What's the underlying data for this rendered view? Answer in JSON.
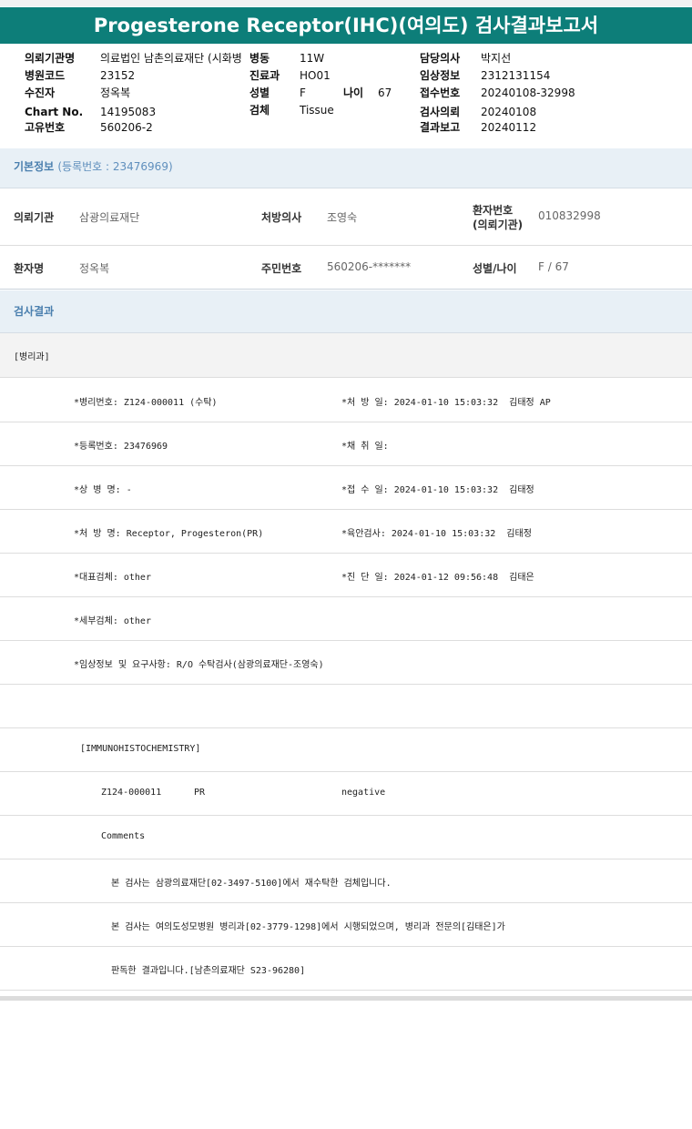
{
  "title": "Progesterone Receptor(IHC)(여의도) 검사결과보고서",
  "header": {
    "r1": {
      "l1": "의뢰기관명",
      "v1": "의료법인 남촌의료재단 (시화병",
      "l2": "병동",
      "v2": "11W",
      "l3": "담당의사",
      "v3": "박지선"
    },
    "r2": {
      "l1": "병원코드",
      "v1": "23152",
      "l2": "진료과",
      "v2": "HO01",
      "l3": "임상정보",
      "v3": "2312131154"
    },
    "r3": {
      "l1": "수진자",
      "v1": "정옥복",
      "l2": "성별",
      "v2": "F",
      "l2b": "나이",
      "v2b": "67",
      "l3": "접수번호",
      "v3": "20240108-32998"
    },
    "r4": {
      "l1": "Chart No.",
      "v1": "14195083",
      "l2": "검체",
      "v2": "Tissue",
      "l3": "검사의뢰",
      "v3": "20240108"
    },
    "r5": {
      "l1": "고유번호",
      "v1": "560206-2",
      "l3": "결과보고",
      "v3": "20240112"
    }
  },
  "basic": {
    "title": "기본정보",
    "subtitle": "(등록번호 : 23476969)",
    "r1": {
      "l1": "의뢰기관",
      "v1": "삼광의료재단",
      "l2": "처방의사",
      "v2": "조영숙",
      "l3a": "환자번호",
      "l3b": "(의뢰기관)",
      "v3": "010832998"
    },
    "r2": {
      "l1": "환자명",
      "v1": "정옥복",
      "l2": "주민번호",
      "v2": "560206-*******",
      "l3": "성별/나이",
      "v3": "F / 67"
    }
  },
  "results": {
    "title": "검사결과",
    "dept": "[병리과]",
    "lines": [
      {
        "left": "*병리번호: Z124-000011 (수탁)",
        "right": "*처 방 일: 2024-01-10 15:03:32  김태정 AP"
      },
      {
        "left": "*등록번호: 23476969",
        "right": "*채 취 일:"
      },
      {
        "left": "*상 병 명: -",
        "right": "*접 수 일: 2024-01-10 15:03:32  김태정"
      },
      {
        "left": "*처 방 명: Receptor, Progesteron(PR)",
        "right": "*육안검사: 2024-01-10 15:03:32  김태정"
      },
      {
        "left": "*대표검체: other",
        "right": "*진 단 일: 2024-01-12 09:56:48  김태은"
      },
      {
        "left": "*세부검체: other",
        "right": ""
      },
      {
        "left": "*임상정보 및 요구사항: R/O 수탁검사(삼광의료재단-조영숙)",
        "right": ""
      }
    ],
    "ihc_header": "[IMMUNOHISTOCHEMISTRY]",
    "ihc": {
      "id": "Z124-000011",
      "marker": "PR",
      "result": "negative"
    },
    "comments_label": "Comments",
    "comment1": "본 검사는 삼광의료재단[02-3497-5100]에서 재수탁한 검체입니다.",
    "comment2": "본 검사는 여의도성모병원 병리과[02-3779-1298]에서 시행되었으며, 병리과 전문의[김태은]가",
    "comment3": "판독한 결과입니다.[남촌의료재단 S23-96280]"
  },
  "colors": {
    "banner": "#0d7e79",
    "section_bg": "#e8f0f6",
    "section_title": "#4a7fae"
  }
}
